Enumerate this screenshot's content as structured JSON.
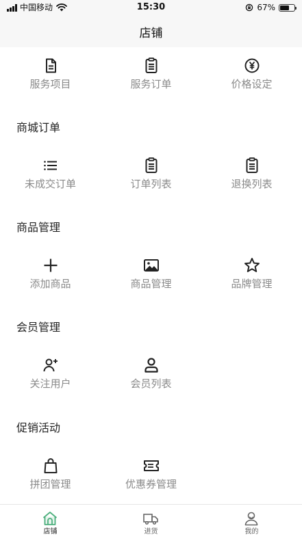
{
  "status_bar": {
    "carrier": "中国移动",
    "time": "15:30",
    "battery": "67%",
    "battery_level": 0.67
  },
  "header": {
    "title": "店铺"
  },
  "top_row": [
    {
      "label": "服务项目",
      "icon": "document-icon"
    },
    {
      "label": "服务订单",
      "icon": "clipboard-icon"
    },
    {
      "label": "价格设定",
      "icon": "yen-circle-icon"
    }
  ],
  "sections": [
    {
      "title": "商城订单",
      "items": [
        {
          "label": "未成交订单",
          "icon": "list-icon"
        },
        {
          "label": "订单列表",
          "icon": "clipboard-icon"
        },
        {
          "label": "退换列表",
          "icon": "clipboard-icon"
        }
      ]
    },
    {
      "title": "商品管理",
      "items": [
        {
          "label": "添加商品",
          "icon": "plus-icon"
        },
        {
          "label": "商品管理",
          "icon": "image-icon"
        },
        {
          "label": "品牌管理",
          "icon": "star-icon"
        }
      ]
    },
    {
      "title": "会员管理",
      "items": [
        {
          "label": "关注用户",
          "icon": "user-add-icon"
        },
        {
          "label": "会员列表",
          "icon": "user-icon"
        }
      ]
    },
    {
      "title": "促销活动",
      "items": [
        {
          "label": "拼团管理",
          "icon": "shopping-bag-icon"
        },
        {
          "label": "优惠券管理",
          "icon": "ticket-icon"
        }
      ]
    }
  ],
  "tab_bar": [
    {
      "label": "店铺",
      "icon": "store-icon",
      "active": true
    },
    {
      "label": "进货",
      "icon": "truck-icon",
      "active": false
    },
    {
      "label": "我的",
      "icon": "profile-icon",
      "active": false
    }
  ],
  "colors": {
    "accent": "#4caf7d",
    "label_gray": "#8a8a8a",
    "header_bg": "#f7f7f7"
  }
}
